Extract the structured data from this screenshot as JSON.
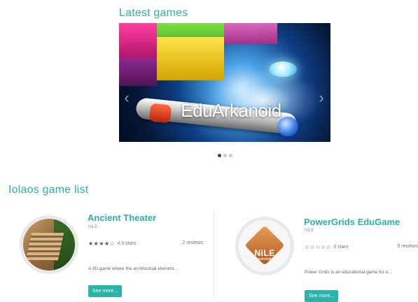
{
  "latest": {
    "heading": "Latest games",
    "slide_title": "EduArkanoid",
    "prev_glyph": "‹",
    "next_glyph": "›",
    "slide_count": 3,
    "active_slide": 1
  },
  "list": {
    "heading": "Iolaos game list",
    "cards": [
      {
        "title": "Ancient Theater",
        "author": "NILE",
        "stars_display": "★★★★☆",
        "rating_text": "4.5 stars",
        "reviews": "2 reviews",
        "description": "A 3D game where the architectual element...",
        "button": "See more..."
      },
      {
        "title": "PowerGrids EduGame",
        "author": "NILE",
        "stars_display": "☆☆☆☆☆",
        "rating_text": "0 stars",
        "reviews": "0 reviews",
        "description": "Power Grids is an educational game for e...",
        "button": "See more...",
        "logo_text": "NiLE",
        "logo_subtext": "gamelab"
      }
    ]
  },
  "colors": {
    "accent": "#2bb3a8",
    "dot_active": "#444444",
    "dot_inactive": "#c9c9c9"
  }
}
